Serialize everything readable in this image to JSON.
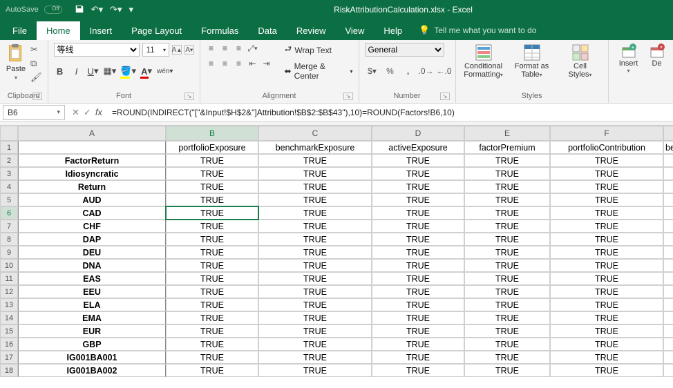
{
  "title_bar": {
    "autosave_label": "AutoSave",
    "doc_title": "RiskAttributionCalculation.xlsx  -  Excel"
  },
  "tabs": {
    "file": "File",
    "home": "Home",
    "insert": "Insert",
    "page_layout": "Page Layout",
    "formulas": "Formulas",
    "data": "Data",
    "review": "Review",
    "view": "View",
    "help": "Help",
    "tell_me": "Tell me what you want to do"
  },
  "ribbon": {
    "clipboard": {
      "paste": "Paste",
      "label": "Clipboard"
    },
    "font": {
      "name": "等线",
      "size": "11",
      "label": "Font"
    },
    "alignment": {
      "wrap": "Wrap Text",
      "merge": "Merge & Center",
      "label": "Alignment"
    },
    "number": {
      "format": "General",
      "label": "Number"
    },
    "styles": {
      "cond": "Conditional",
      "cond2": "Formatting",
      "fmt": "Format as",
      "fmt2": "Table",
      "cell": "Cell",
      "cell2": "Styles",
      "label": "Styles"
    },
    "cells": {
      "insert": "Insert",
      "delete": "De"
    }
  },
  "formula_bar": {
    "name_box": "B6",
    "formula": "=ROUND(INDIRECT(\"[\"&Input!$H$2&\"]Attribution!$B$2:$B$43\"),10)=ROUND(Factors!B6,10)"
  },
  "sheet": {
    "col_letters": [
      "A",
      "B",
      "C",
      "D",
      "E",
      "F"
    ],
    "headers": [
      "",
      "portfolioExposure",
      "benchmarkExposure",
      "activeExposure",
      "factorPremium",
      "portfolioContribution",
      "be"
    ],
    "row_labels": [
      "FactorReturn",
      "Idiosyncratic",
      "Return",
      "AUD",
      "CAD",
      "CHF",
      "DAP",
      "DEU",
      "DNA",
      "EAS",
      "EEU",
      "ELA",
      "EMA",
      "EUR",
      "GBP",
      "IG001BA001",
      "IG001BA002"
    ],
    "cell_value": "TRUE",
    "active": {
      "row": 6,
      "col": "B"
    }
  },
  "chart_data": {
    "type": "table",
    "note": "All visible data cells show TRUE; see headers and row_labels"
  }
}
